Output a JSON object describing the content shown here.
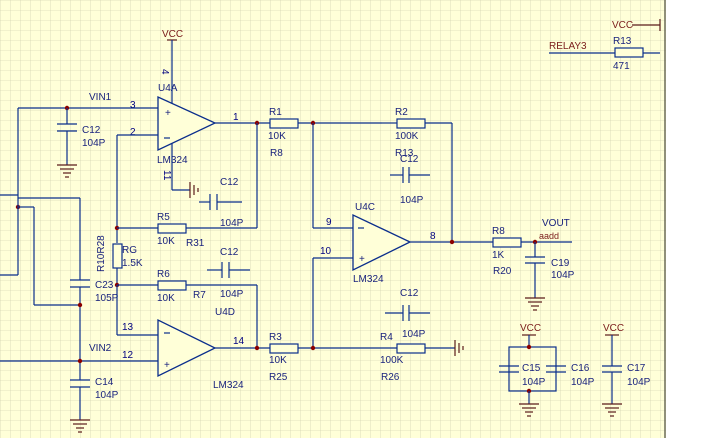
{
  "nets": {
    "vcc_top": "VCC",
    "vcc_right": "VCC",
    "vcc_c15": "VCC",
    "vcc_c17": "VCC",
    "relay": "RELAY3",
    "vin1": "VIN1",
    "vin2": "VIN2",
    "vout": "VOUT",
    "aadd": "aadd"
  },
  "opamps": {
    "u4a": {
      "ref": "U4A",
      "part": "LM324",
      "pin_plus": "3",
      "pin_minus": "2",
      "pin_out": "1",
      "pin_vcc": "4",
      "pin_gnd": "11"
    },
    "u4c": {
      "ref": "U4C",
      "part": "LM324",
      "pin_minus": "9",
      "pin_plus": "10",
      "pin_out": "8"
    },
    "u4d": {
      "ref": "U4D",
      "part": "LM324",
      "pin_minus": "13",
      "pin_plus": "12",
      "pin_out": "14"
    }
  },
  "resistors": {
    "r13": {
      "ref": "R13",
      "value": "471"
    },
    "r1": {
      "ref": "R1",
      "value": "10K",
      "alt": "R8"
    },
    "r2": {
      "ref": "R2",
      "value": "100K",
      "alt": "R13"
    },
    "r5": {
      "ref": "R5",
      "value": "10K",
      "alt": "R31"
    },
    "r6": {
      "ref": "R6",
      "value": "10K",
      "alt": "R7"
    },
    "rg": {
      "ref": "RG",
      "value": "1.5K",
      "alt": "R10R28"
    },
    "r3": {
      "ref": "R3",
      "value": "10K",
      "alt": "R25"
    },
    "r4": {
      "ref": "R4",
      "value": "100K",
      "alt": "R26"
    },
    "r8": {
      "ref": "R8",
      "value": "1K",
      "alt": "R20"
    }
  },
  "capacitors": {
    "c12_vin1": {
      "ref": "C12",
      "value": "104P"
    },
    "c12_u4a": {
      "ref": "C12",
      "value": "104P"
    },
    "c12_r2": {
      "ref": "C12",
      "value": "104P"
    },
    "c12_r6": {
      "ref": "C12",
      "value": "104P"
    },
    "c12_r4": {
      "ref": "C12",
      "value": "104P"
    },
    "c23": {
      "ref": "C23",
      "value": "105P"
    },
    "c14": {
      "ref": "C14",
      "value": "104P"
    },
    "c19": {
      "ref": "C19",
      "value": "104P"
    },
    "c15": {
      "ref": "C15",
      "value": "104P"
    },
    "c16": {
      "ref": "C16",
      "value": "104P"
    },
    "c17": {
      "ref": "C17",
      "value": "104P"
    }
  },
  "colors": {
    "background": "#ffffd8",
    "grid": "#c8c8a8",
    "wire": "#0b2e8c",
    "net_label": "#7a1b1b",
    "junction": "#8b0000"
  }
}
